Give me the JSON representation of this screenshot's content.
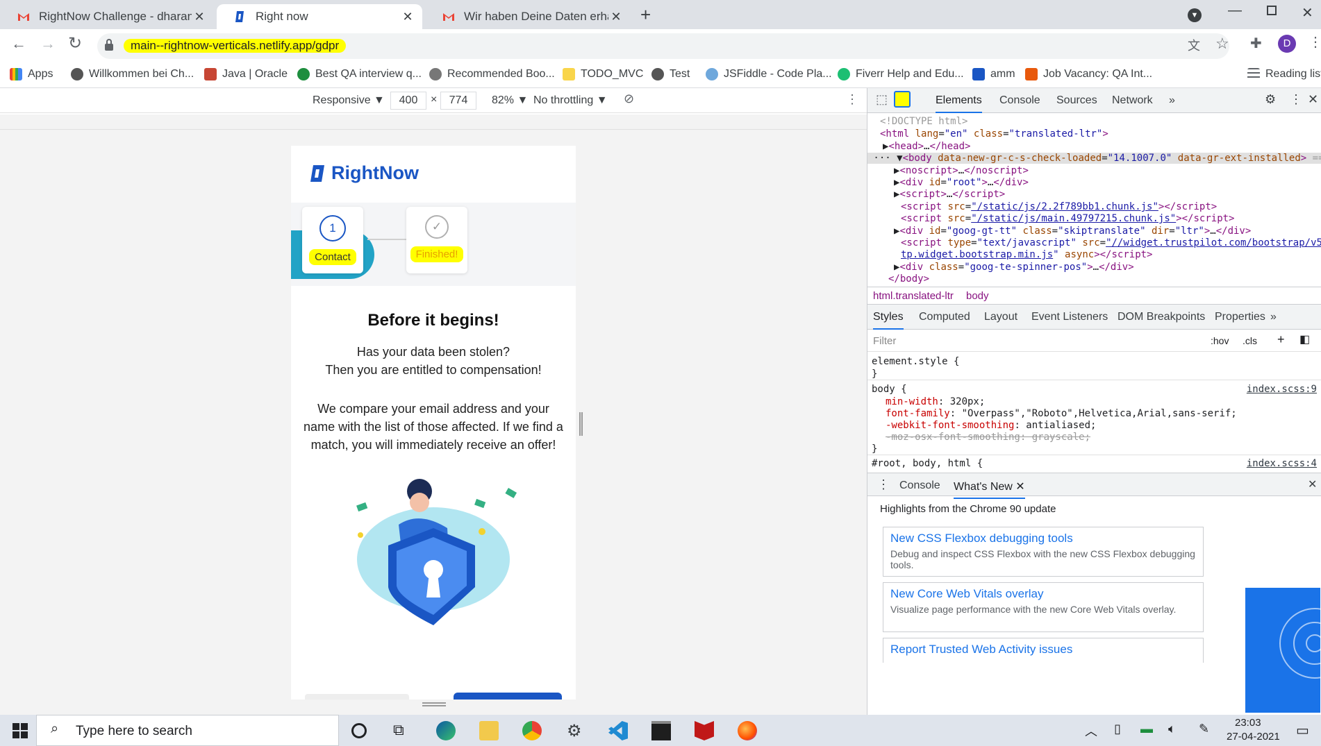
{
  "tabs": [
    {
      "title": "RightNow Challenge - dharani.g"
    },
    {
      "title": "Right now"
    },
    {
      "title": "Wir haben Deine Daten erhalten"
    }
  ],
  "address": {
    "url": "main--rightnow-verticals.netlify.app/gdpr",
    "profile_initial": "D"
  },
  "bookmarks": [
    "Apps",
    "Willkommen bei Ch...",
    "Java | Oracle",
    "Best QA interview q...",
    "Recommended Boo...",
    "TODO_MVC",
    "Test",
    "JSFiddle - Code Pla...",
    "Fiverr Help and Edu...",
    "amm",
    "Job Vacancy: QA Int...",
    "Reading list"
  ],
  "device_toolbar": {
    "mode": "Responsive",
    "width": "400",
    "height": "774",
    "zoom": "82%",
    "throttle": "No throttling"
  },
  "page": {
    "logo": "RightNow",
    "steps": [
      {
        "number": "1",
        "label": "Contact"
      },
      {
        "number": "",
        "label": "Finished!"
      }
    ],
    "heading": "Before it begins!",
    "para1_line1": "Has your data been stolen?",
    "para1_line2": "Then you are entitled to compensation!",
    "para2": "We compare your email address and your name with the list of those affected. If we find a match, you will immediately receive an offer!"
  },
  "devtools": {
    "tabs": [
      "Elements",
      "Console",
      "Sources",
      "Network"
    ],
    "breadcrumb": [
      "html.translated-ltr",
      "body"
    ],
    "styles_tabs": [
      "Styles",
      "Computed",
      "Layout",
      "Event Listeners",
      "DOM Breakpoints",
      "Properties"
    ],
    "filter_placeholder": "Filter",
    "hov": ":hov",
    "cls": ".cls",
    "element_style": "element.style {",
    "body_rule": "body {",
    "source1": "index.scss:9",
    "source2": "index.scss:4",
    "root_rule": "#root, body, html {",
    "drawer_tabs": [
      "Console",
      "What's New"
    ],
    "highlights": "Highlights from the Chrome 90 update",
    "news": [
      {
        "title": "New CSS Flexbox debugging tools",
        "desc": "Debug and inspect CSS Flexbox with the new CSS Flexbox debugging tools."
      },
      {
        "title": "New Core Web Vitals overlay",
        "desc": "Visualize page performance with the new Core Web Vitals overlay."
      },
      {
        "title": "Report Trusted Web Activity issues",
        "desc": ""
      }
    ]
  },
  "taskbar": {
    "search_placeholder": "Type here to search",
    "time": "23:03",
    "date": "27-04-2021"
  }
}
